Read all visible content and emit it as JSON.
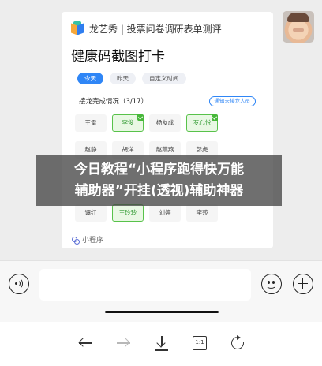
{
  "card": {
    "app_name": "龙艺秀 | 投票问卷调研表单测评",
    "title": "健康码截图打卡",
    "tabs": [
      {
        "label": "今天",
        "active": true
      },
      {
        "label": "昨天",
        "active": false
      },
      {
        "label": "自定义时间",
        "active": false
      }
    ],
    "progress_label": "接龙完成情况（3/17）",
    "notify_button": "通知未接龙人员",
    "members": [
      {
        "name": "王雷",
        "done": false
      },
      {
        "name": "李俊",
        "done": true
      },
      {
        "name": "杨友成",
        "done": false
      },
      {
        "name": "罗心悦",
        "done": true
      },
      {
        "name": "赵静",
        "done": false
      },
      {
        "name": "胡洋",
        "done": false
      },
      {
        "name": "赵燕燕",
        "done": false
      },
      {
        "name": "彭虎",
        "done": false
      },
      {
        "name": "谭红",
        "done": false
      },
      {
        "name": "王玲玲",
        "done": true
      },
      {
        "name": "刘婷",
        "done": false
      },
      {
        "name": "李莎",
        "done": false
      }
    ],
    "footer_label": "小程序"
  },
  "overlay": {
    "line1": "今日教程“小程序跑得快万能",
    "line2": "辅助器”开挂(透视)辅助神器"
  },
  "input_bar": {
    "placeholder": ""
  },
  "browser_bar": {
    "zoom_label": "1:1"
  },
  "colors": {
    "accent": "#2f86f6",
    "done_green": "#47b83a",
    "background": "#ededed"
  }
}
